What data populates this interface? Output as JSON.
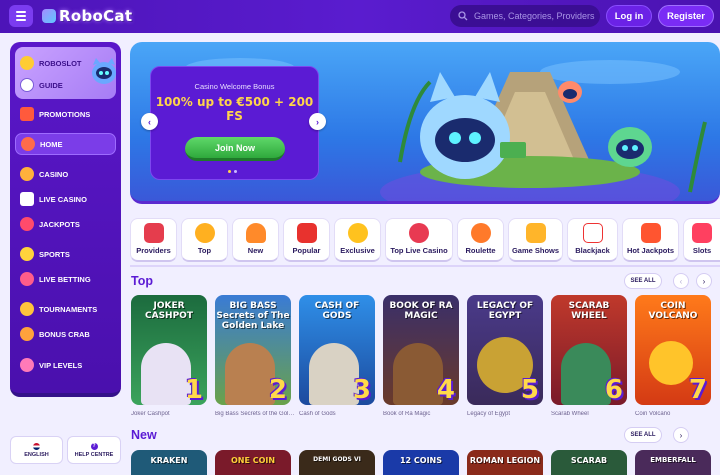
{
  "header": {
    "logo_text": "RoboCat",
    "search_placeholder": "Games, Categories, Providers",
    "login_label": "Log in",
    "register_label": "Register"
  },
  "sidebar": {
    "promo_items": [
      {
        "label": "Roboslot",
        "icon": "coin-icon"
      },
      {
        "label": "Guide",
        "icon": "guide-icon"
      }
    ],
    "items": [
      {
        "label": "Promotions",
        "icon": "gift-icon"
      },
      {
        "label": "Home",
        "icon": "home-icon"
      },
      {
        "label": "Casino",
        "icon": "slot-icon"
      },
      {
        "label": "Live Casino",
        "icon": "cards-icon"
      },
      {
        "label": "Jackpots",
        "icon": "jackpot-icon"
      },
      {
        "label": "Sports",
        "icon": "ball-icon"
      },
      {
        "label": "Live Betting",
        "icon": "live-icon"
      },
      {
        "label": "Tournaments",
        "icon": "trophy-icon"
      },
      {
        "label": "Bonus Crab",
        "icon": "crab-icon"
      },
      {
        "label": "VIP Levels",
        "icon": "vip-icon"
      }
    ],
    "language_label": "ENGLISH",
    "help_label": "HELP CENTRE"
  },
  "hero": {
    "eyebrow": "Casino Welcome Bonus",
    "title": "100% up to €500 + 200 FS",
    "cta": "Join Now"
  },
  "categories": [
    "Providers",
    "Top",
    "New",
    "Popular",
    "Exclusive",
    "Top Live Casino",
    "Roulette",
    "Game Shows",
    "Blackjack",
    "Hot Jackpots",
    "Slots"
  ],
  "top": {
    "title": "Top",
    "see_all": "SEE ALL",
    "games": [
      {
        "art": "JOKER CASHPOT",
        "name": "Joker Cashpot",
        "rank": "1"
      },
      {
        "art": "BIG BASS Secrets of The Golden Lake",
        "name": "Big Bass Secrets of the Golden Lake",
        "rank": "2"
      },
      {
        "art": "CASH OF GODS",
        "name": "Cash of Gods",
        "rank": "3"
      },
      {
        "art": "BOOK OF RA MAGIC",
        "name": "Book of Ra Magic",
        "rank": "4"
      },
      {
        "art": "LEGACY OF EGYPT",
        "name": "Legacy of Egypt",
        "rank": "5"
      },
      {
        "art": "SCARAB WHEEL",
        "name": "Scarab Wheel",
        "rank": "6"
      },
      {
        "art": "COIN VOLCANO",
        "name": "Coin Volcano",
        "rank": "7"
      }
    ]
  },
  "new": {
    "title": "New",
    "see_all": "SEE ALL",
    "games": [
      "KRAKEN",
      "ONE COIN",
      "DEMI GODS VI",
      "12 COINS",
      "ROMAN LEGION",
      "SCARAB",
      "EMBERFALL"
    ]
  }
}
